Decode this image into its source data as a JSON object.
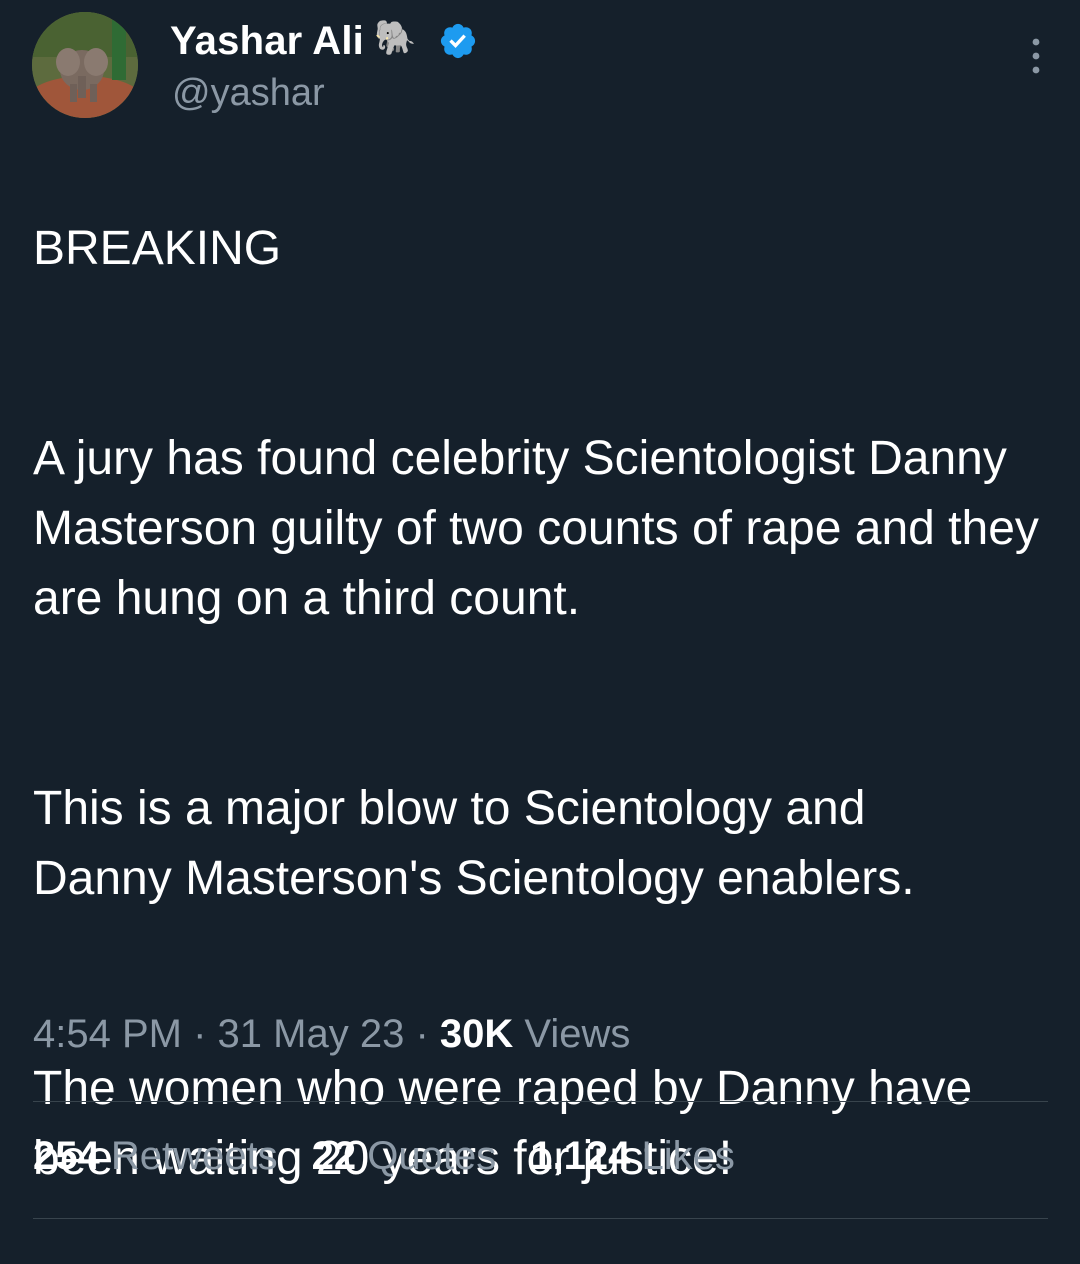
{
  "author": {
    "display_name": "Yashar Ali",
    "name_emoji": "🐘",
    "handle": "@yashar",
    "verified_color": "#1d9bf0"
  },
  "tweet": {
    "paragraphs": [
      "BREAKING",
      "A jury has found celebrity Scientologist Danny Masterson guilty of two counts of rape and they are hung on a third count.",
      "This is a major blow to Scientology and Danny Masterson's Scientology enablers.",
      "The women who were raped by Danny have been waiting 20 years for justice!"
    ],
    "time": "4:54 PM",
    "date": "31 May 23",
    "separator": "·",
    "views_count": "30K",
    "views_label": "Views"
  },
  "stats": {
    "retweets_count": "254",
    "retweets_label": "Retweets",
    "quotes_count": "22",
    "quotes_label": "Quotes",
    "likes_count": "1,124",
    "likes_label": "Likes"
  },
  "icons": {
    "more": "more-vertical-icon",
    "verified": "verified-badge-icon"
  },
  "colors": {
    "background": "#15202b",
    "secondary_text": "#8b98a5",
    "divider": "#38444d"
  }
}
